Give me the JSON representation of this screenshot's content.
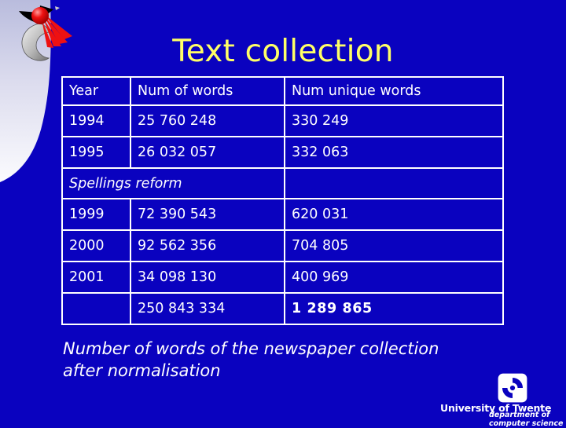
{
  "slide": {
    "title": "Text collection",
    "background_color": "#0a02bf",
    "title_color": "#ffff66"
  },
  "table": {
    "headers": [
      "Year",
      "Num of words",
      "Num unique words"
    ],
    "rows": [
      {
        "year": "1994",
        "words": "25 760 248",
        "unique": "330 249"
      },
      {
        "year": "1995",
        "words": "26 032 057",
        "unique": "332 063"
      }
    ],
    "note_row": {
      "label": "Spellings reform"
    },
    "rows2": [
      {
        "year": "1999",
        "words": "72 390 543",
        "unique": "620 031"
      },
      {
        "year": "2000",
        "words": "92 562 356",
        "unique": "704 805"
      },
      {
        "year": "2001",
        "words": "34 098 130",
        "unique": "400 969"
      }
    ],
    "total_row": {
      "year": "",
      "words": "250 843 334",
      "unique": "1 289 865"
    }
  },
  "caption": {
    "line1": "Number of words of the newspaper collection",
    "line2": "after normalisation"
  },
  "university_logo": {
    "name": "University of Twente",
    "dept_line1": "department of",
    "dept_line2": "computer science"
  }
}
